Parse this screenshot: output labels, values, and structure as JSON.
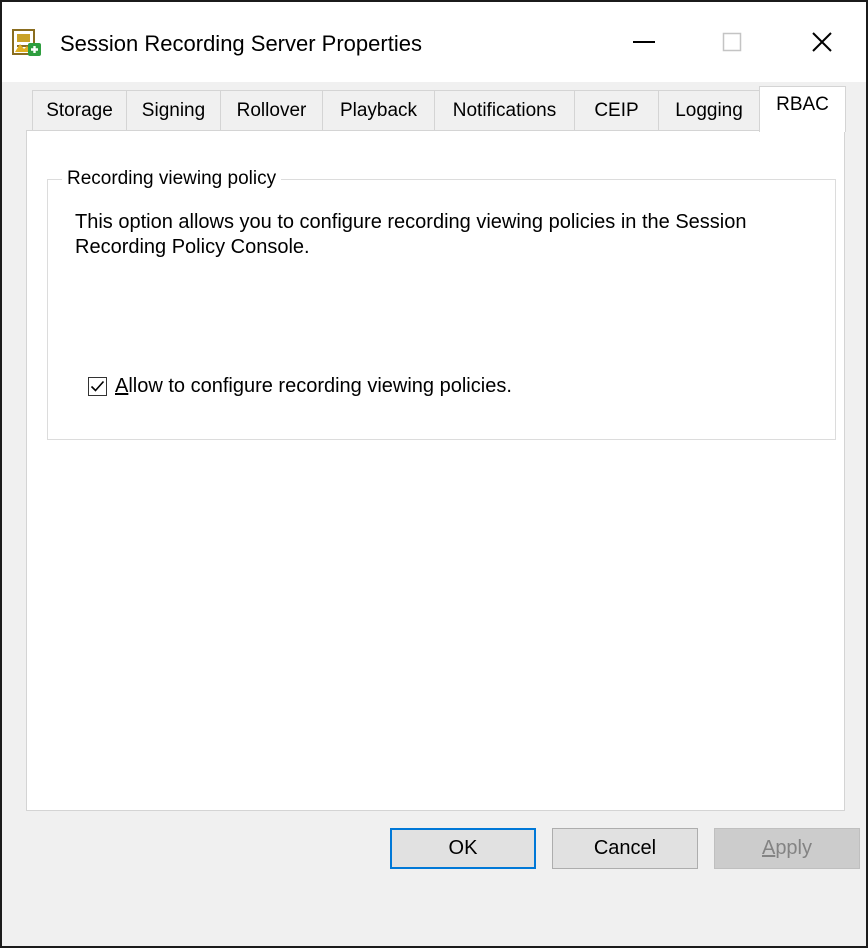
{
  "window": {
    "title": "Session Recording Server Properties",
    "icon": "session-recording-server-icon"
  },
  "caption_buttons": {
    "minimize_icon": "minimize-icon",
    "maximize_icon": "maximize-icon",
    "close_icon": "close-icon"
  },
  "tabs": [
    {
      "label": "Storage",
      "active": false
    },
    {
      "label": "Signing",
      "active": false
    },
    {
      "label": "Rollover",
      "active": false
    },
    {
      "label": "Playback",
      "active": false
    },
    {
      "label": "Notifications",
      "active": false
    },
    {
      "label": "CEIP",
      "active": false
    },
    {
      "label": "Logging",
      "active": false
    },
    {
      "label": "RBAC",
      "active": true
    }
  ],
  "group": {
    "title": "Recording viewing policy",
    "description": "This option allows you to configure recording viewing policies in the Session Recording Policy Console.",
    "checkbox": {
      "mnemonic": "A",
      "label_rest": "llow to configure recording viewing policies.",
      "checked": true
    }
  },
  "buttons": {
    "ok": "OK",
    "cancel": "Cancel",
    "apply_mnemonic": "A",
    "apply_rest": "pply"
  },
  "colors": {
    "accent": "#0078d7",
    "window_border": "#1b1b1b",
    "dialog_bg": "#f0f0f0",
    "panel_bg": "#ffffff",
    "disabled_text": "#838383"
  }
}
